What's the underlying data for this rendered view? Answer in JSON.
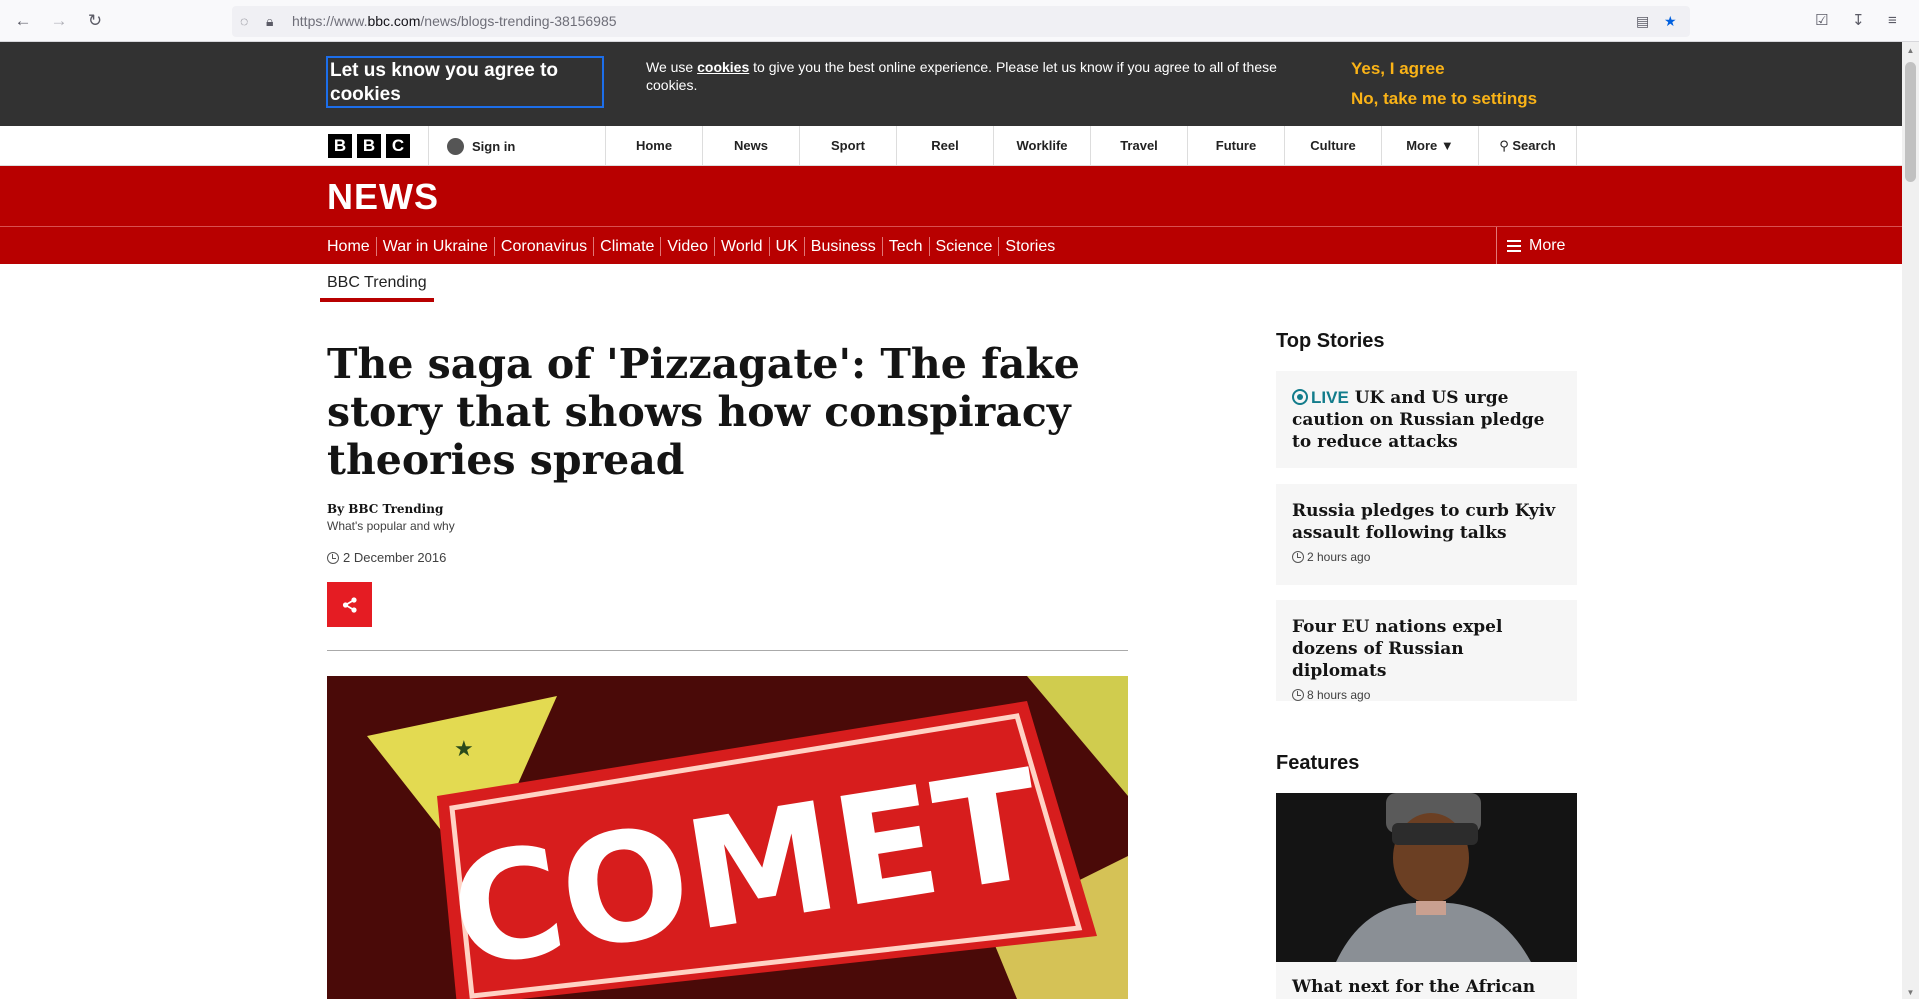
{
  "browser": {
    "url_prefix": "https://www.",
    "url_domain": "bbc.com",
    "url_path": "/news/blogs-trending-38156985"
  },
  "cookie_banner": {
    "title": "Let us know you agree to cookies",
    "text_before": "We use ",
    "link": "cookies",
    "text_after": " to give you the best online experience. Please let us know if you agree to all of these cookies.",
    "agree": "Yes, I agree",
    "settings": "No, take me to settings"
  },
  "global_nav": {
    "logo": [
      "B",
      "B",
      "C"
    ],
    "signin": "Sign in",
    "items": [
      "Home",
      "News",
      "Sport",
      "Reel",
      "Worklife",
      "Travel",
      "Future",
      "Culture"
    ],
    "more": "More",
    "search": "Search"
  },
  "masthead": {
    "brand": "NEWS"
  },
  "sub_nav": {
    "items": [
      "Home",
      "War in Ukraine",
      "Coronavirus",
      "Climate",
      "Video",
      "World",
      "UK",
      "Business",
      "Tech",
      "Science",
      "Stories"
    ],
    "more": "More"
  },
  "section": "BBC Trending",
  "article": {
    "headline": "The saga of 'Pizzagate': The fake story that shows how conspiracy theories spread",
    "byline": "By BBC Trending",
    "by_desc": "What's popular and why",
    "date": "2 December 2016",
    "hero_sign_text": "COMET"
  },
  "sidebar": {
    "top_stories_title": "Top Stories",
    "stories": [
      {
        "live": "LIVE",
        "headline": "UK and US urge caution on Russian pledge to reduce attacks",
        "time": ""
      },
      {
        "live": "",
        "headline": "Russia pledges to curb Kyiv assault following talks",
        "time": "2 hours ago"
      },
      {
        "live": "",
        "headline": "Four EU nations expel dozens of Russian diplomats",
        "time": "8 hours ago"
      }
    ],
    "features_title": "Features",
    "feature_headline": "What next for the African"
  },
  "colors": {
    "bbc_red": "#b80000",
    "cookie_bg": "#323232",
    "cookie_accent": "#fab317",
    "live_teal": "#127c8b"
  }
}
